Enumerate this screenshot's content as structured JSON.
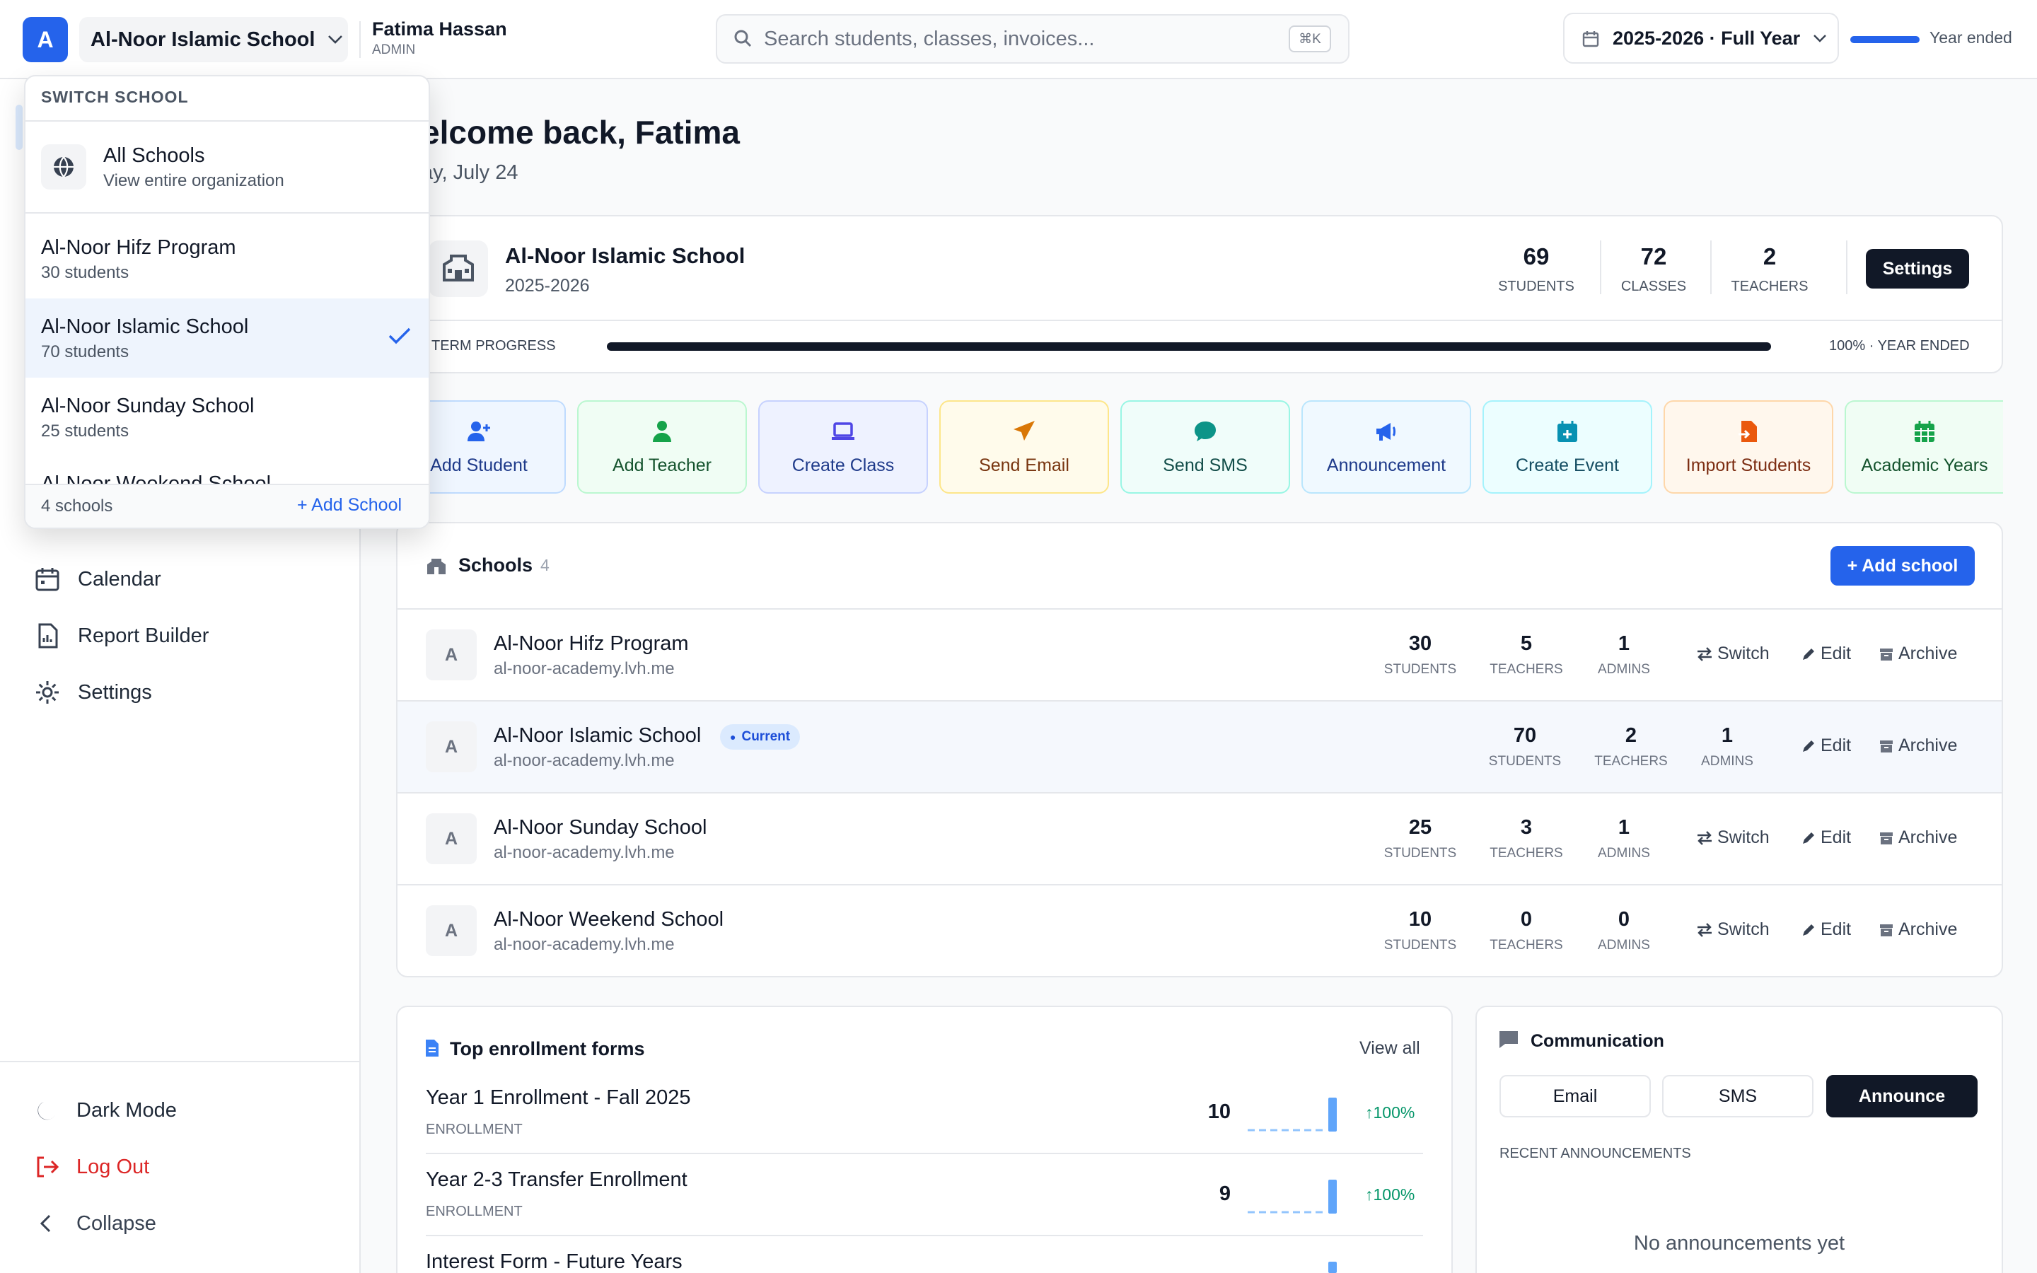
{
  "topbar": {
    "logo_letter": "A",
    "school_selector": "Al-Noor Islamic School",
    "user_name": "Fatima Hassan",
    "user_role": "ADMIN",
    "search_placeholder": "Search students, classes, invoices...",
    "shortcut": "⌘K",
    "year_selector": "2025-2026 · Full Year",
    "year_progress": 1.0,
    "year_status": "Year ended"
  },
  "dropdown": {
    "heading": "SWITCH SCHOOL",
    "all_title": "All Schools",
    "all_sub": "View entire organization",
    "items": [
      {
        "name": "Al-Noor Hifz Program",
        "sub": "30 students"
      },
      {
        "name": "Al-Noor Islamic School",
        "sub": "70 students",
        "selected": true
      },
      {
        "name": "Al-Noor Sunday School",
        "sub": "25 students"
      },
      {
        "name": "Al-Noor Weekend School",
        "sub": ""
      }
    ],
    "count": "4 schools",
    "add_label": "+ Add School"
  },
  "sidebar": {
    "items": [
      {
        "label": "Calendar",
        "icon": "calendar-icon"
      },
      {
        "label": "Report Builder",
        "icon": "report-icon"
      },
      {
        "label": "Settings",
        "icon": "gear-icon"
      }
    ],
    "dark_mode": "Dark Mode",
    "logout": "Log Out",
    "collapse": "Collapse"
  },
  "main": {
    "welcome": "elcome back, Fatima",
    "date": "ay, July 24",
    "school_card": {
      "title": "Al-Noor Islamic School",
      "year": "2025-2026",
      "stats": [
        {
          "value": "69",
          "label": "STUDENTS"
        },
        {
          "value": "72",
          "label": "CLASSES"
        },
        {
          "value": "2",
          "label": "TEACHERS"
        }
      ],
      "settings_label": "Settings",
      "term_label": "TERM PROGRESS",
      "term_progress": 1.0,
      "term_value": "100% · YEAR ENDED"
    },
    "quick_actions": [
      {
        "label": "Add Student",
        "icon": "add-user-icon",
        "color": "#2563eb",
        "bg": "#eff6ff",
        "border": "#bfdbfe"
      },
      {
        "label": "Add Teacher",
        "icon": "teacher-icon",
        "color": "#16a34a",
        "bg": "#f0fdf4",
        "border": "#bbf7d0"
      },
      {
        "label": "Create Class",
        "icon": "laptop-icon",
        "color": "#4f46e5",
        "bg": "#eef2ff",
        "border": "#c7d2fe"
      },
      {
        "label": "Send Email",
        "icon": "paper-plane-icon",
        "color": "#d97706",
        "bg": "#fffbeb",
        "border": "#fde68a"
      },
      {
        "label": "Send SMS",
        "icon": "sms-icon",
        "color": "#0d9488",
        "bg": "#f0fdfa",
        "border": "#99f6e4"
      },
      {
        "label": "Announcement",
        "icon": "megaphone-icon",
        "color": "#2563eb",
        "bg": "#f0f9ff",
        "border": "#bae6fd"
      },
      {
        "label": "Create Event",
        "icon": "calendar-plus-icon",
        "color": "#0891b2",
        "bg": "#ecfeff",
        "border": "#a5f3fc"
      },
      {
        "label": "Import Students",
        "icon": "file-import-icon",
        "color": "#ea580c",
        "bg": "#fff7ed",
        "border": "#fed7aa"
      },
      {
        "label": "Academic Years",
        "icon": "calendar-grid-icon",
        "color": "#16a34a",
        "bg": "#f0fdf4",
        "border": "#bbf7d0"
      }
    ],
    "schools": {
      "title": "Schools",
      "count": "4",
      "add_label": "+ Add school",
      "current_badge": "Current",
      "stat_labels": [
        "STUDENTS",
        "TEACHERS",
        "ADMINS"
      ],
      "actions": {
        "switch": "Switch",
        "edit": "Edit",
        "archive": "Archive"
      },
      "rows": [
        {
          "avatar": "A",
          "name": "Al-Noor Hifz Program",
          "domain": "al-noor-academy.lvh.me",
          "students": "30",
          "teachers": "5",
          "admins": "1",
          "current": false
        },
        {
          "avatar": "A",
          "name": "Al-Noor Islamic School",
          "domain": "al-noor-academy.lvh.me",
          "students": "70",
          "teachers": "2",
          "admins": "1",
          "current": true
        },
        {
          "avatar": "A",
          "name": "Al-Noor Sunday School",
          "domain": "al-noor-academy.lvh.me",
          "students": "25",
          "teachers": "3",
          "admins": "1",
          "current": false
        },
        {
          "avatar": "A",
          "name": "Al-Noor Weekend School",
          "domain": "al-noor-academy.lvh.me",
          "students": "10",
          "teachers": "0",
          "admins": "0",
          "current": false
        }
      ]
    },
    "forms": {
      "title": "Top enrollment forms",
      "view_all": "View all",
      "items": [
        {
          "name": "Year 1 Enrollment - Fall 2025",
          "tag": "ENROLLMENT",
          "count": "10",
          "change": "100%"
        },
        {
          "name": "Year 2-3 Transfer Enrollment",
          "tag": "ENROLLMENT",
          "count": "9",
          "change": "100%"
        },
        {
          "name": "Interest Form - Future Years",
          "tag": "",
          "count": "",
          "change": ""
        }
      ]
    },
    "communication": {
      "title": "Communication",
      "tabs": [
        "Email",
        "SMS",
        "Announce"
      ],
      "active_tab": "Announce",
      "recent_label": "RECENT ANNOUNCEMENTS",
      "empty": "No announcements yet"
    }
  }
}
